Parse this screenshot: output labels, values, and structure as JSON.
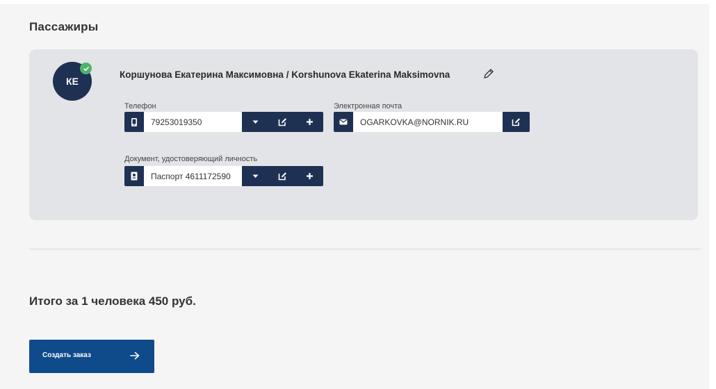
{
  "section": {
    "title": "Пассажиры"
  },
  "passenger": {
    "initials": "КЕ",
    "name": "Коршунова Екатерина Максимовна / Korshunova Ekaterina Maksimovna",
    "phone": {
      "label": "Телефон",
      "value": "79253019350"
    },
    "email": {
      "label": "Электронная почта",
      "value": "OGARKOVKA@NORNIK.RU"
    },
    "document": {
      "label": "Документ, удостоверяющий личность",
      "value": "Паспорт 4611172590"
    }
  },
  "summary": {
    "total": "Итого за 1 человека 450 руб."
  },
  "actions": {
    "create_order": "Создать заказ"
  },
  "colors": {
    "accent_dark": "#1f3153",
    "primary_button": "#0f4a8a",
    "verified": "#4fb26a",
    "card_bg": "#e3e4e7"
  },
  "icons": [
    "check-icon",
    "pencil-icon",
    "phone-icon",
    "caret-down-icon",
    "edit-icon",
    "plus-icon",
    "envelope-icon",
    "document-icon",
    "arrow-right-icon"
  ]
}
